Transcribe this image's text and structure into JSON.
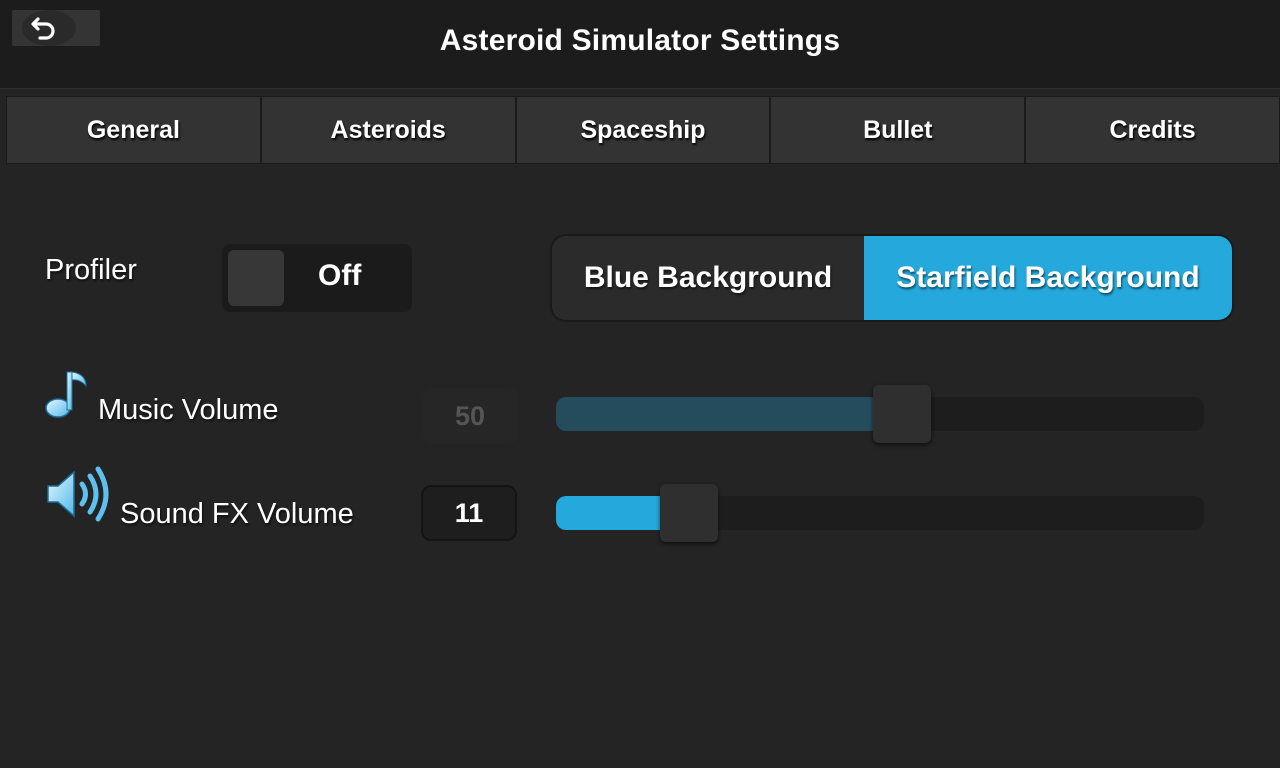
{
  "header": {
    "title": "Asteroid Simulator Settings",
    "back_icon": "undo-arrow-icon"
  },
  "tabs": [
    {
      "label": "General"
    },
    {
      "label": "Asteroids"
    },
    {
      "label": "Spaceship"
    },
    {
      "label": "Bullet"
    },
    {
      "label": "Credits"
    }
  ],
  "profiler": {
    "label": "Profiler",
    "state": "Off"
  },
  "background": {
    "options": [
      "Blue Background",
      "Starfield Background"
    ],
    "selected": "Starfield Background"
  },
  "music": {
    "label": "Music Volume",
    "value": "50",
    "level": 0.5,
    "icon": "music-note-icon"
  },
  "sfx": {
    "label": "Sound FX Volume",
    "value": "11",
    "level": 0.11,
    "icon": "speaker-icon"
  },
  "colors": {
    "accent": "#25a9dd",
    "music_fill": "#244c5c",
    "background": "#242424"
  }
}
